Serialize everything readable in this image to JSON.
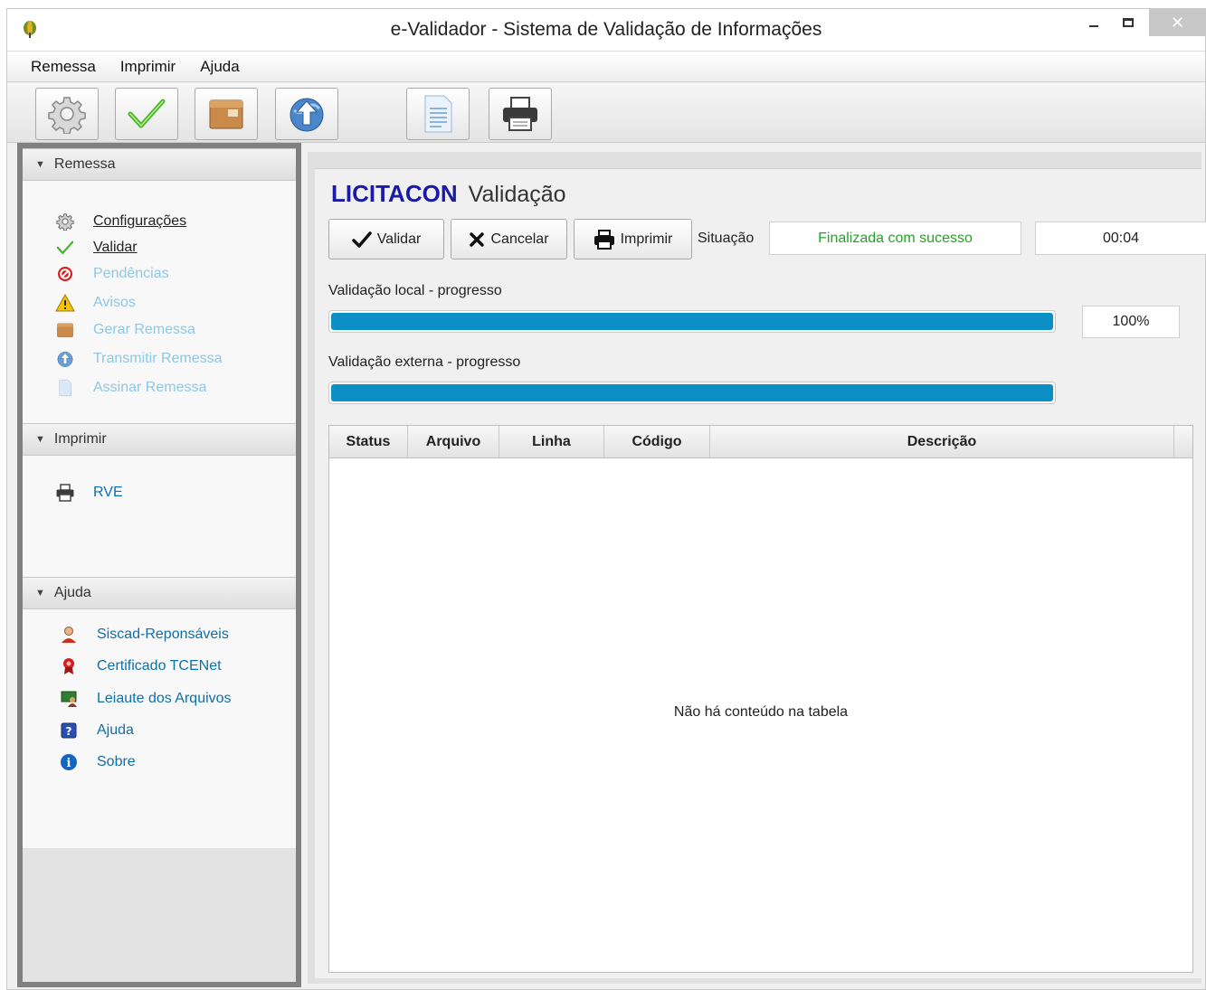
{
  "window": {
    "title": "e-Validador - Sistema de Validação de Informações",
    "controls": {
      "minimize": "–",
      "maximize": "□",
      "close": "✕"
    }
  },
  "menu": {
    "items": [
      "Remessa",
      "Imprimir",
      "Ajuda"
    ]
  },
  "toolbar": {
    "buttons": [
      {
        "icon": "gear-icon"
      },
      {
        "icon": "check-icon"
      },
      {
        "icon": "package-icon"
      },
      {
        "icon": "globe-upload-icon"
      },
      {
        "icon": "document-icon"
      },
      {
        "icon": "printer-icon"
      }
    ]
  },
  "sidebar": {
    "remessa": {
      "header": "Remessa",
      "items": [
        {
          "label": "Configurações",
          "icon": "gear-icon",
          "state": "active"
        },
        {
          "label": "Validar",
          "icon": "check-icon",
          "state": "active"
        },
        {
          "label": "Pendências",
          "icon": "forbidden-icon",
          "state": "disabled"
        },
        {
          "label": "Avisos",
          "icon": "warning-icon",
          "state": "disabled"
        },
        {
          "label": "Gerar Remessa",
          "icon": "package-icon",
          "state": "disabled"
        },
        {
          "label": "Transmitir Remessa",
          "icon": "globe-icon",
          "state": "disabled"
        },
        {
          "label": "Assinar Remessa",
          "icon": "document-icon",
          "state": "disabled"
        }
      ]
    },
    "imprimir": {
      "header": "Imprimir",
      "items": [
        {
          "label": "RVE",
          "icon": "printer-icon"
        }
      ]
    },
    "ajuda": {
      "header": "Ajuda",
      "items": [
        {
          "label": "Siscad-Reponsáveis",
          "icon": "user-icon"
        },
        {
          "label": "Certificado TCENet",
          "icon": "certificate-icon"
        },
        {
          "label": "Leiaute dos Arquivos",
          "icon": "presentation-icon"
        },
        {
          "label": "Ajuda",
          "icon": "help-icon"
        },
        {
          "label": "Sobre",
          "icon": "info-icon"
        }
      ]
    }
  },
  "main": {
    "brand": "LICITACON",
    "subtitle": "Validação",
    "buttons": {
      "validar": "Validar",
      "cancelar": "Cancelar",
      "imprimir": "Imprimir"
    },
    "situacao_label": "Situação",
    "situacao_value": "Finalizada com sucesso",
    "elapsed": "00:04",
    "local_label": "Validação local - progresso",
    "local_progress": 100,
    "local_percent": "100%",
    "external_label": "Validação externa - progresso",
    "external_progress": 100,
    "table": {
      "columns": [
        "Status",
        "Arquivo",
        "Linha",
        "Código",
        "Descrição"
      ],
      "empty_message": "Não há conteúdo na tabela"
    }
  },
  "colors": {
    "brand": "#1a1aa8",
    "success": "#26a326",
    "progress": "#0b8fc4",
    "link": "#0f6fa8",
    "disabled_link": "#8fc7e4"
  }
}
